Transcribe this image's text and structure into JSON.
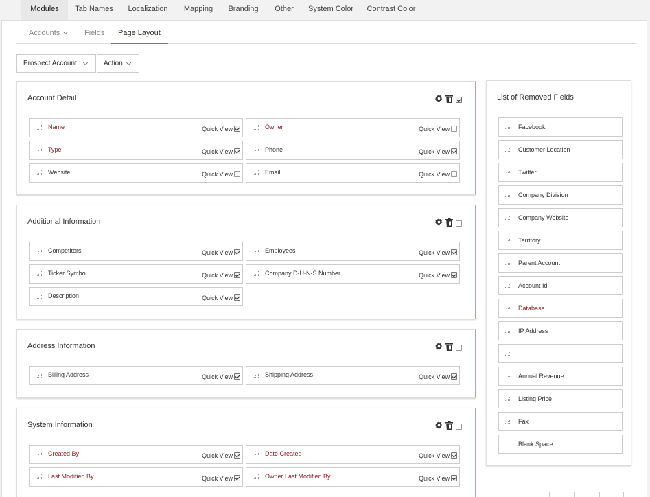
{
  "top_tabs": [
    "Modules",
    "Tab Names",
    "Localization",
    "Mapping",
    "Branding",
    "Other",
    "System Color",
    "Contrast Color"
  ],
  "sub_tabs": {
    "accounts": "Accounts",
    "fields": "Fields",
    "page_layout": "Page Layout"
  },
  "toolbar": {
    "layout_select": "Prospect Account",
    "action": "Action"
  },
  "quick_view_label": "Quick View",
  "sections": [
    {
      "title": "Account Detail",
      "section_checked": true,
      "fields": [
        {
          "label": "Name",
          "required": true,
          "quick_view": true
        },
        {
          "label": "Owner",
          "required": true,
          "quick_view": false
        },
        {
          "label": "Type",
          "required": true,
          "quick_view": true
        },
        {
          "label": "Phone",
          "required": false,
          "quick_view": true
        },
        {
          "label": "Website",
          "required": false,
          "quick_view": false
        },
        {
          "label": "Email",
          "required": false,
          "quick_view": false
        }
      ]
    },
    {
      "title": "Additional Information",
      "section_checked": false,
      "fields": [
        {
          "label": "Competitors",
          "required": false,
          "quick_view": true
        },
        {
          "label": "Employees",
          "required": false,
          "quick_view": true
        },
        {
          "label": "Ticker Symbol",
          "required": false,
          "quick_view": true
        },
        {
          "label": "Company D-U-N-S Number",
          "required": false,
          "quick_view": true
        },
        {
          "label": "Description",
          "required": false,
          "quick_view": true
        }
      ]
    },
    {
      "title": "Address Information",
      "section_checked": false,
      "fields": [
        {
          "label": "Billing Address",
          "required": false,
          "quick_view": true
        },
        {
          "label": "Shipping Address",
          "required": false,
          "quick_view": true
        }
      ]
    },
    {
      "title": "System Information",
      "section_checked": false,
      "fields": [
        {
          "label": "Created By",
          "required": true,
          "quick_view": true
        },
        {
          "label": "Date Created",
          "required": true,
          "quick_view": true
        },
        {
          "label": "Last Modified By",
          "required": true,
          "quick_view": true
        },
        {
          "label": "Owner Last Modified By",
          "required": true,
          "quick_view": true
        }
      ]
    }
  ],
  "removed_fields": {
    "title": "List of Removed Fields",
    "items": [
      {
        "label": "Facebook",
        "required": false
      },
      {
        "label": "Customer Location",
        "required": false
      },
      {
        "label": "Twitter",
        "required": false
      },
      {
        "label": "Company Division",
        "required": false
      },
      {
        "label": "Company Website",
        "required": false
      },
      {
        "label": "Territory",
        "required": false
      },
      {
        "label": "Parent Account",
        "required": false
      },
      {
        "label": "Account Id",
        "required": false
      },
      {
        "label": "Database",
        "required": true
      },
      {
        "label": "IP Address",
        "required": false
      },
      {
        "label": "",
        "required": false
      },
      {
        "label": "Annual Revenue",
        "required": false
      },
      {
        "label": "Listing Price",
        "required": false
      },
      {
        "label": "Fax",
        "required": false
      },
      {
        "label": "Blank Space",
        "required": false,
        "no_grip": true
      }
    ]
  },
  "colors": {
    "accent": "#c9467c",
    "required_label": "#8b1a1a",
    "section_edge": "#8cbf8c",
    "removed_edge": "#cc4444"
  }
}
